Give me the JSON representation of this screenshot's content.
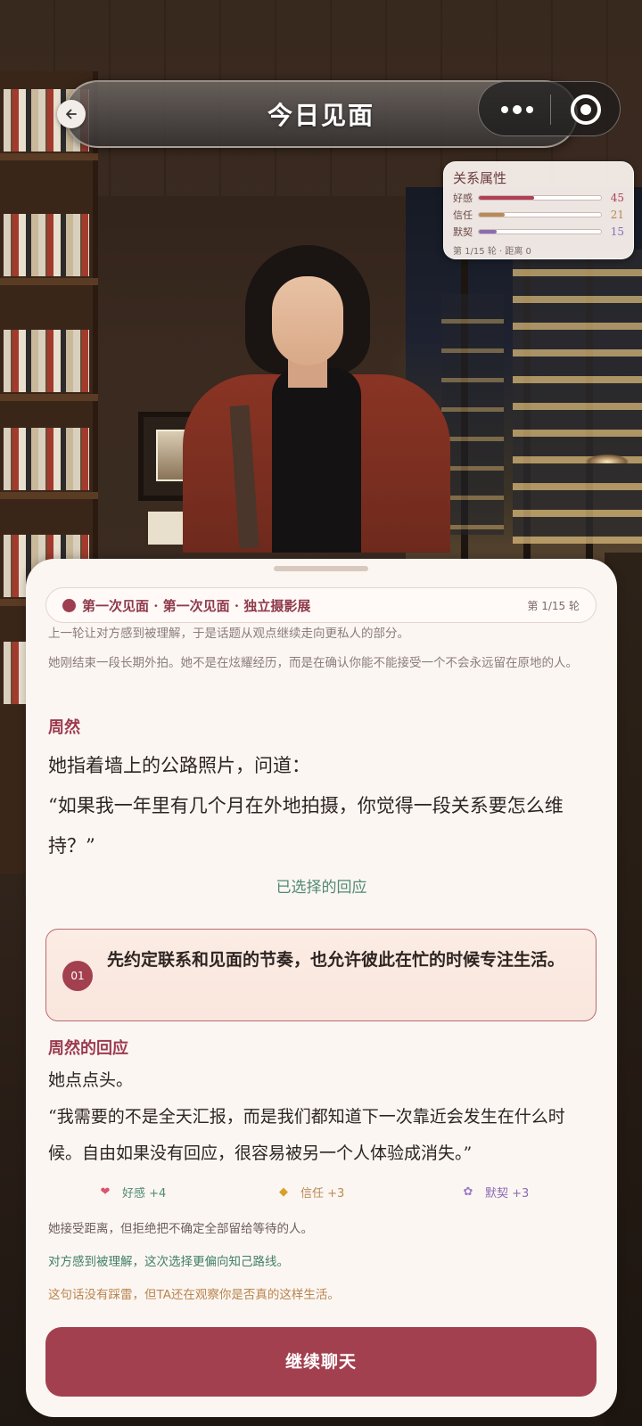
{
  "header": {
    "title": "今日见面"
  },
  "relationship": {
    "title": "关系属性",
    "stats": [
      {
        "label": "好感",
        "value": "45",
        "fraction": 0.45,
        "color": "#b03f55"
      },
      {
        "label": "信任",
        "value": "21",
        "fraction": 0.21,
        "color": "#b98a55"
      },
      {
        "label": "默契",
        "value": "15",
        "fraction": 0.15,
        "color": "#8a6cb3"
      }
    ],
    "footer": "第 1/15 轮 · 距离 0"
  },
  "scene": {
    "title": "第一次见面 · 第一次见面 · 独立摄影展",
    "round": "第 1/15 轮"
  },
  "narration": {
    "line1": "上一轮让对方感到被理解，于是话题从观点继续走向更私人的部分。",
    "line2": "她刚结束一段长期外拍。她不是在炫耀经历，而是在确认你能不能接受一个不会永远留在原地的人。"
  },
  "question": {
    "speaker": "周然",
    "action": "她指着墙上的公路照片，问道：",
    "quote": "“如果我一年里有几个月在外地拍摄，你觉得一段关系要怎么维持？”"
  },
  "choice": {
    "label": "已选择的回应",
    "number": "01",
    "text": "先约定联系和见面的节奏，也允许彼此在忙的时候专注生活。"
  },
  "response": {
    "speaker": "周然的回应",
    "action": "她点点头。",
    "quote": "“我需要的不是全天汇报，而是我们都知道下一次靠近会发生在什么时候。自由如果没有回应，很容易被另一个人体验成消失。”"
  },
  "stat_changes": [
    {
      "icon": "heart-icon",
      "label": "好感 +4",
      "color": "#4f8a73"
    },
    {
      "icon": "trust-gem-icon",
      "label": "信任 +3",
      "color": "#b98a55"
    },
    {
      "icon": "lotus-icon",
      "label": "默契 +3",
      "color": "#8a6cb3"
    }
  ],
  "notes": [
    {
      "text": "她接受距离，但拒绝把不确定全部留给等待的人。",
      "color": "#6b5f5c"
    },
    {
      "text": "对方感到被理解，这次选择更偏向知己路线。",
      "color": "#3d7f66"
    },
    {
      "text": "这句话没有踩雷，但TA还在观察你是否真的这样生活。",
      "color": "#b9854f"
    }
  ],
  "actions": {
    "continue_label": "继续聊天"
  }
}
